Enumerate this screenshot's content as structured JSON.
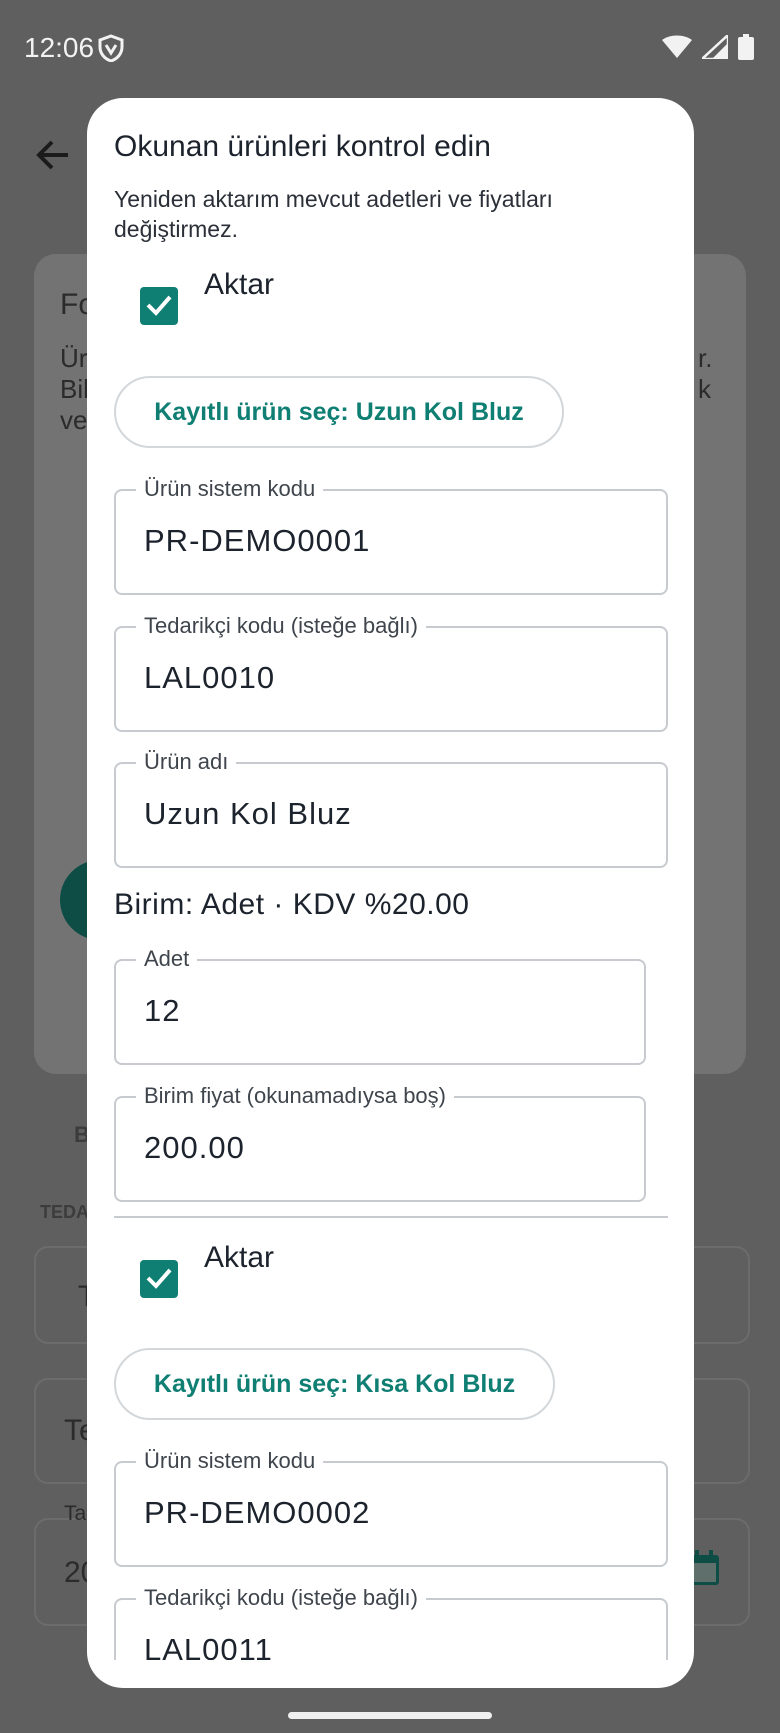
{
  "status_bar": {
    "time": "12:06"
  },
  "background": {
    "card_title_fragment": "Fo",
    "card_text_fragments": [
      "Ür",
      "Bil",
      "ve",
      "r.",
      "k"
    ],
    "section_fragment": "B",
    "tedarikci_label_fragment": "TEDA",
    "field_fragments": [
      "T",
      "Te",
      "Ta",
      "20"
    ]
  },
  "dialog": {
    "title": "Okunan ürünleri kontrol edin",
    "subtitle": "Yeniden aktarım mevcut adetleri ve fiyatları değiştirmez.",
    "items": [
      {
        "checkbox_label": "Aktar",
        "checked": true,
        "pick_button": "Kayıtlı ürün seç: Uzun Kol Bluz",
        "fields": [
          {
            "label": "Ürün sistem kodu",
            "value": "PR-DEMO0001"
          },
          {
            "label": "Tedarikçi kodu (isteğe bağlı)",
            "value": "LAL0010"
          },
          {
            "label": "Ürün adı",
            "value": "Uzun Kol Bluz"
          }
        ],
        "unit_line": "Birim: Adet · KDV %20.00",
        "quantity": {
          "label": "Adet",
          "value": "12"
        },
        "price": {
          "label": "Birim fiyat (okunamadıysa boş)",
          "value": "200.00"
        }
      },
      {
        "checkbox_label": "Aktar",
        "checked": true,
        "pick_button": "Kayıtlı ürün seç: Kısa Kol Bluz",
        "fields": [
          {
            "label": "Ürün sistem kodu",
            "value": "PR-DEMO0002"
          },
          {
            "label": "Tedarikçi kodu (isteğe bağlı)",
            "value": "LAL0011"
          }
        ]
      }
    ]
  },
  "colors": {
    "accent": "#0f7e73",
    "scrim": "#5f5f5f"
  }
}
